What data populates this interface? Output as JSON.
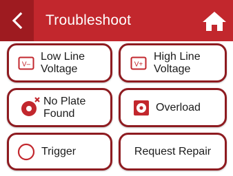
{
  "header": {
    "title": "Troubleshoot",
    "back_icon": "chevron-left-icon",
    "home_icon": "home-icon"
  },
  "buttons": [
    {
      "label": "Low Line\nVoltage",
      "icon": "low-voltage-icon",
      "icon_glyph": "V–"
    },
    {
      "label": "High Line\nVoltage",
      "icon": "high-voltage-icon",
      "icon_glyph": "V+"
    },
    {
      "label": "No Plate\nFound",
      "icon": "no-plate-icon"
    },
    {
      "label": "Overload",
      "icon": "overload-icon"
    },
    {
      "label": "Trigger",
      "icon": "trigger-icon"
    },
    {
      "label": "Request Repair"
    }
  ],
  "colors": {
    "header": "#c2272d",
    "header_dark": "#9e1b20",
    "button_border": "#8e1b20"
  }
}
